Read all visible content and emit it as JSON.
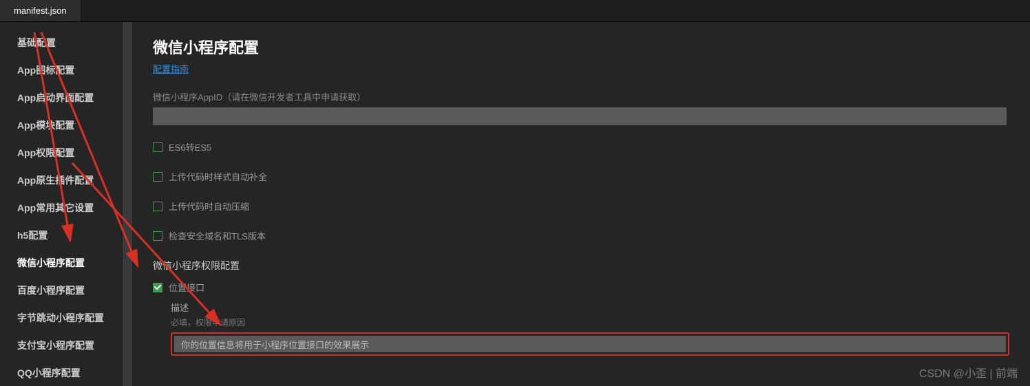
{
  "tab": {
    "title": "manifest.json"
  },
  "sidebar": {
    "items": [
      {
        "label": "基础配置"
      },
      {
        "label": "App图标配置"
      },
      {
        "label": "App启动界面配置"
      },
      {
        "label": "App模块配置"
      },
      {
        "label": "App权限配置"
      },
      {
        "label": "App原生插件配置"
      },
      {
        "label": "App常用其它设置"
      },
      {
        "label": "h5配置"
      },
      {
        "label": "微信小程序配置"
      },
      {
        "label": "百度小程序配置"
      },
      {
        "label": "字节跳动小程序配置"
      },
      {
        "label": "支付宝小程序配置"
      },
      {
        "label": "QQ小程序配置"
      }
    ],
    "active_index": 8
  },
  "main": {
    "title": "微信小程序配置",
    "guide_link": "配置指南",
    "appid_label": "微信小程序AppID（请在微信开发者工具中申请获取）",
    "appid_value": "",
    "checks": [
      {
        "label": "ES6转ES5",
        "checked": false
      },
      {
        "label": "上传代码时样式自动补全",
        "checked": false
      },
      {
        "label": "上传代码时自动压缩",
        "checked": false
      },
      {
        "label": "检查安全域名和TLS版本",
        "checked": false
      }
    ],
    "perm_section_title": "微信小程序权限配置",
    "perm_location": {
      "label": "位置接口",
      "checked": true
    },
    "desc_label": "描述",
    "desc_hint": "必填，权限申请原因",
    "desc_value": "你的位置信息将用于小程序位置接口的效果展示"
  },
  "watermark": "CSDN @小歪 | 前端",
  "colors": {
    "accent_green": "#3d9a50",
    "link_blue": "#3490dc",
    "highlight_red": "#d93025",
    "bg": "#252526"
  }
}
